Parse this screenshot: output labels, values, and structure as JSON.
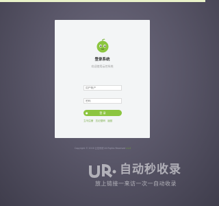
{
  "login": {
    "title": "登录系统",
    "subtitle": "欢迎使用云控系统",
    "username_placeholder": "用户帐户",
    "password_placeholder": "密码",
    "submit_label": "登 录",
    "links": [
      "立马注册",
      "忘记密码",
      "返回"
    ]
  },
  "footer": {
    "copyright": "Copyright © 2016 云控系统 All Rights Reserved",
    "version": "v1.0"
  },
  "watermark": {
    "title": "自动秒收录",
    "subtitle": "放上链接一来访一次一自动收录"
  },
  "colors": {
    "accent": "#8cc540",
    "card_bg": "#f3f5f6",
    "background": "#5a5769",
    "top_bar": "#e9f2c9"
  },
  "icons": [
    "mascot-logo",
    "login-user-icon"
  ]
}
